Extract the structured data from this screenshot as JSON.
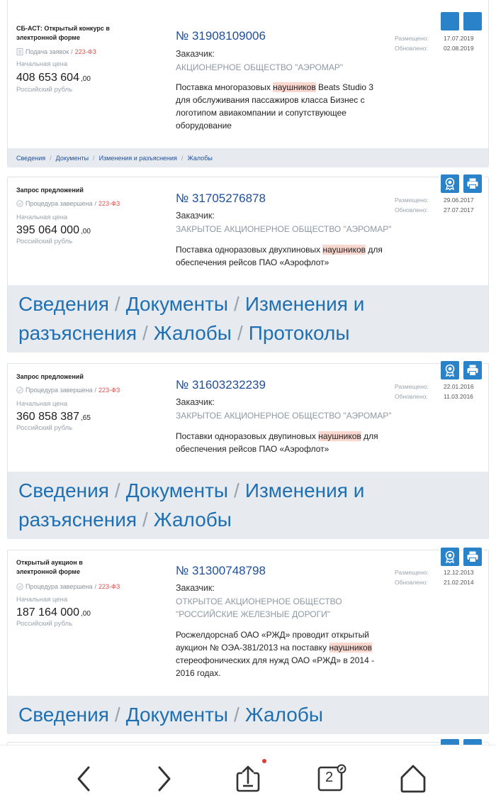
{
  "cards": [
    {
      "type": "СБ-АСТ: Открытый конкурс в электронной форме",
      "status": "Подача заявок",
      "law": "223-ФЗ",
      "price_label": "Начальная цена",
      "price": "408 653 604",
      "cents": ",00",
      "currency": "Российский рубль",
      "number": "№ 31908109006",
      "customer_label": "Заказчик:",
      "customer": "АКЦИОНЕРНОЕ ОБЩЕСТВО \"АЭРОМАР\"",
      "desc_pre": "Поставка многоразовых ",
      "desc_mark": "наушников",
      "desc_post": " Beats Studio 3 для обслуживания пассажиров класса Бизнес с логотипом авиакомпании и сопутствующее оборудование",
      "placed_label": "Размещено:",
      "placed": "17.07.2019",
      "updated_label": "Обновлено:",
      "updated": "02.08.2019",
      "links": [
        "Сведения",
        "Документы",
        "Изменения и разъяснения",
        "Жалобы"
      ]
    },
    {
      "type": "Запрос предложений",
      "status": "Процедура завершена",
      "law": "223-ФЗ",
      "price_label": "Начальная цена",
      "price": "395 064 000",
      "cents": ",00",
      "currency": "Российский рубль",
      "number": "№ 31705276878",
      "customer_label": "Заказчик:",
      "customer": "ЗАКРЫТОЕ АКЦИОНЕРНОЕ ОБЩЕСТВО \"АЭРОМАР\"",
      "desc_pre": "Поставка одноразовых двухпиновых ",
      "desc_mark": "наушников",
      "desc_post": " для обеспечения рейсов ПАО «Аэрофлот»",
      "placed_label": "Размещено:",
      "placed": "29.06.2017",
      "updated_label": "Обновлено:",
      "updated": "27.07.2017",
      "links": [
        "Сведения",
        "Документы",
        "Изменения и разъяснения",
        "Жалобы",
        "Протоколы"
      ]
    },
    {
      "type": "Запрос предложений",
      "status": "Процедура завершена",
      "law": "223-ФЗ",
      "price_label": "Начальная цена",
      "price": "360 858 387",
      "cents": ",65",
      "currency": "Российский рубль",
      "number": "№ 31603232239",
      "customer_label": "Заказчик:",
      "customer": "ЗАКРЫТОЕ АКЦИОНЕРНОЕ ОБЩЕСТВО \"АЭРОМАР\"",
      "desc_pre": "Поставки одноразовых двупиновых ",
      "desc_mark": "наушников",
      "desc_post": " для обеспечения рейсов ПАО «Аэрофлот»",
      "placed_label": "Размещено:",
      "placed": "22.01.2016",
      "updated_label": "Обновлено:",
      "updated": "11.03.2016",
      "links": [
        "Сведения",
        "Документы",
        "Изменения и разъяснения",
        "Жалобы"
      ]
    },
    {
      "type": "Открытый аукцион в электронной форме",
      "status": "Процедура завершена",
      "law": "223-ФЗ",
      "price_label": "Начальная цена",
      "price": "187 164 000",
      "cents": ",00",
      "currency": "Российский рубль",
      "number": "№ 31300748798",
      "customer_label": "Заказчик:",
      "customer": "ОТКРЫТОЕ АКЦИОНЕРНОЕ ОБЩЕСТВО \"РОССИЙСКИЕ ЖЕЛЕЗНЫЕ ДОРОГИ\"",
      "desc_pre": "Росжелдорснаб ОАО «РЖД» проводит открытый аукцион № ОЭА-381/2013 на поставку ",
      "desc_mark": "наушников",
      "desc_post": " стереофонических для нужд ОАО «РЖД» в 2014 - 2016 годах.",
      "placed_label": "Размещено:",
      "placed": "12.12.2013",
      "updated_label": "Обновлено:",
      "updated": "21.02.2014",
      "links": [
        "Сведения",
        "Документы",
        "Жалобы"
      ]
    }
  ],
  "nav": {
    "tabs_count": "2",
    "icons": [
      "back-icon",
      "forward-icon",
      "share-icon",
      "tabs-icon",
      "home-icon"
    ],
    "notification_color": "#e53935"
  },
  "colors": {
    "accent": "#2a82c8",
    "link": "#1f6fb3",
    "highlight": "#fad7cf",
    "law": "#d9534f"
  }
}
